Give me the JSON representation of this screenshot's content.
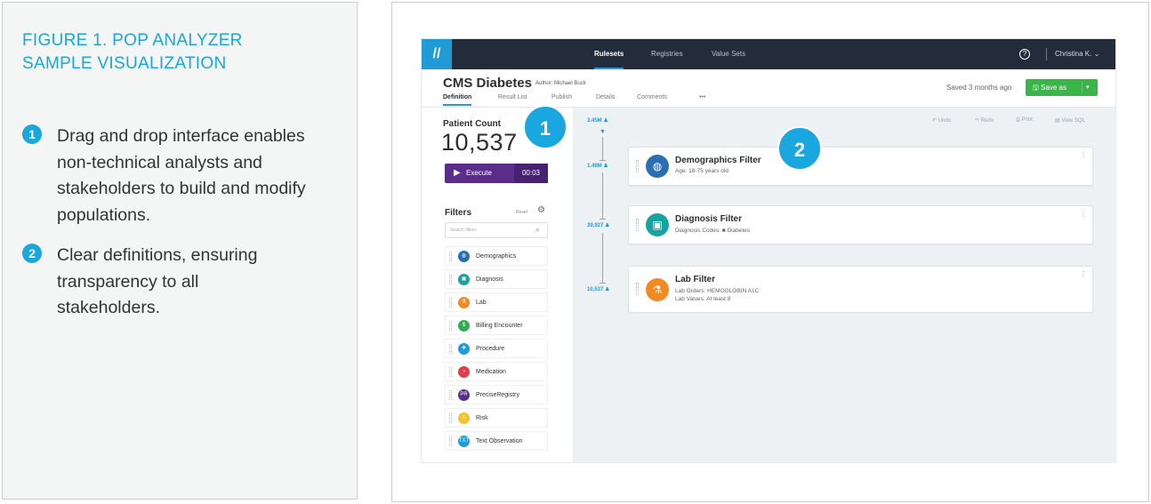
{
  "caption": {
    "title": "FIGURE 1. POP ANALYZER SAMPLE VISUALIZATION",
    "items": [
      {
        "num": "1",
        "text": "Drag and drop interface enables non-technical analysts and stakeholders to build and modify populations."
      },
      {
        "num": "2",
        "text": "Clear definitions, ensuring transparency to all stakeholders."
      }
    ]
  },
  "app": {
    "logo": "//",
    "nav": [
      "Rulesets",
      "Registries",
      "Value Sets"
    ],
    "help": "?",
    "user": "Christina K. ⌄",
    "ruleset_title": "CMS Diabetes",
    "author": "Author: Michael Buck",
    "saved": "Saved 3 months ago",
    "save_button": "🖫  Save as",
    "save_caret": "▾",
    "tabs": [
      "Definition",
      "Result List",
      "Publish",
      "Details",
      "Comments",
      "•••"
    ],
    "patient_count_label": "Patient Count",
    "patient_count": "10,537",
    "execute_label": "Execute",
    "execute_time": "00:03",
    "filters_label": "Filters",
    "filters_reset": "Reset",
    "search_placeholder": "Search filters",
    "filter_items": [
      {
        "label": "Demographics",
        "color": "#2b6fb3",
        "icon": "globe-icon"
      },
      {
        "label": "Diagnosis",
        "color": "#17a3a0",
        "icon": "clipboard-icon"
      },
      {
        "label": "Lab",
        "color": "#f08a24",
        "icon": "flask-icon"
      },
      {
        "label": "Billing Encounter",
        "color": "#2fae4f",
        "icon": "dollar-icon"
      },
      {
        "label": "Procedure",
        "color": "#1f9bd7",
        "icon": "procedure-icon"
      },
      {
        "label": "Medication",
        "color": "#e23d4b",
        "icon": "pill-icon"
      },
      {
        "label": "PreciseRegistry",
        "color": "#5a2d8a",
        "icon": "registry-icon"
      },
      {
        "label": "Risk",
        "color": "#f5c22b",
        "icon": "risk-icon"
      },
      {
        "label": "Text Observation",
        "color": "#1f9bd7",
        "icon": "text-icon"
      }
    ],
    "toolbar": [
      "↶ Undo",
      "↷ Redo",
      "⎙ Print",
      "▤ View SQL"
    ],
    "counts": [
      "3.45M ♟",
      "1.49M ♟",
      "39,927 ♟",
      "10,537 ♟"
    ],
    "funnel": "▼",
    "cards": [
      {
        "name": "Demographics Filter",
        "lines": [
          "Age: 18-75 years old"
        ],
        "color": "#2b6fb3",
        "icon": "globe-icon",
        "glyph": "◍"
      },
      {
        "name": "Diagnosis Filter",
        "lines": [
          "Diagnosis Codes: ■ Diabetes"
        ],
        "color": "#17a3a0",
        "icon": "clipboard-icon",
        "glyph": "▣"
      },
      {
        "name": "Lab Filter",
        "lines": [
          "Lab Orders: HEMOGLOBIN A1C",
          "Lab Values: At least 8"
        ],
        "color": "#f08a24",
        "icon": "flask-icon",
        "glyph": "⚗"
      }
    ],
    "kebab": "⋮"
  },
  "badges": [
    "1",
    "2"
  ]
}
